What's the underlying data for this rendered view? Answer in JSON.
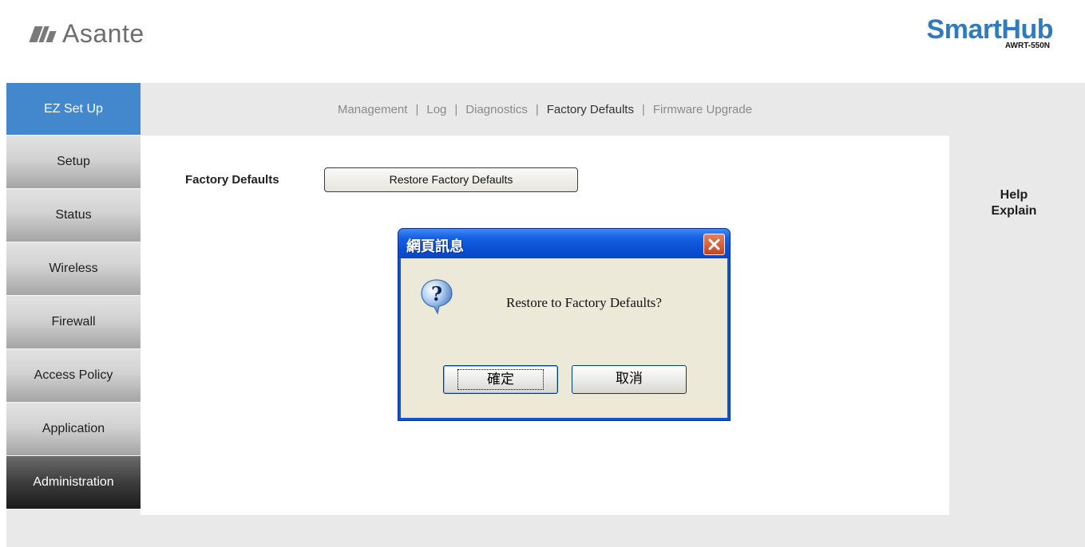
{
  "header": {
    "left_logo_text": "Asante",
    "right_brand": "SmartHub",
    "right_model": "AWRT-550N"
  },
  "sidebar": {
    "items": [
      {
        "label": "EZ Set Up"
      },
      {
        "label": "Setup"
      },
      {
        "label": "Status"
      },
      {
        "label": "Wireless"
      },
      {
        "label": "Firewall"
      },
      {
        "label": "Access Policy"
      },
      {
        "label": "Application"
      },
      {
        "label": "Administration"
      }
    ]
  },
  "topnav": {
    "items": [
      {
        "label": "Management"
      },
      {
        "label": "Log"
      },
      {
        "label": "Diagnostics"
      },
      {
        "label": "Factory Defaults",
        "active": true
      },
      {
        "label": "Firmware Upgrade"
      }
    ],
    "separator": "|"
  },
  "main": {
    "factory_label": "Factory Defaults",
    "restore_button": "Restore Factory Defaults"
  },
  "help": {
    "line1": "Help",
    "line2": "Explain"
  },
  "dialog": {
    "title": "網頁訊息",
    "message": "Restore to Factory Defaults?",
    "ok_label": "確定",
    "cancel_label": "取消",
    "icon": "question-icon"
  },
  "colors": {
    "ez_setup_bg": "#4388cc",
    "brand_blue": "#2e7bbf",
    "frame_gray": "#e9e9e9",
    "dialog_title_blue": "#0a4fd3",
    "dialog_body": "#ece9d8"
  }
}
